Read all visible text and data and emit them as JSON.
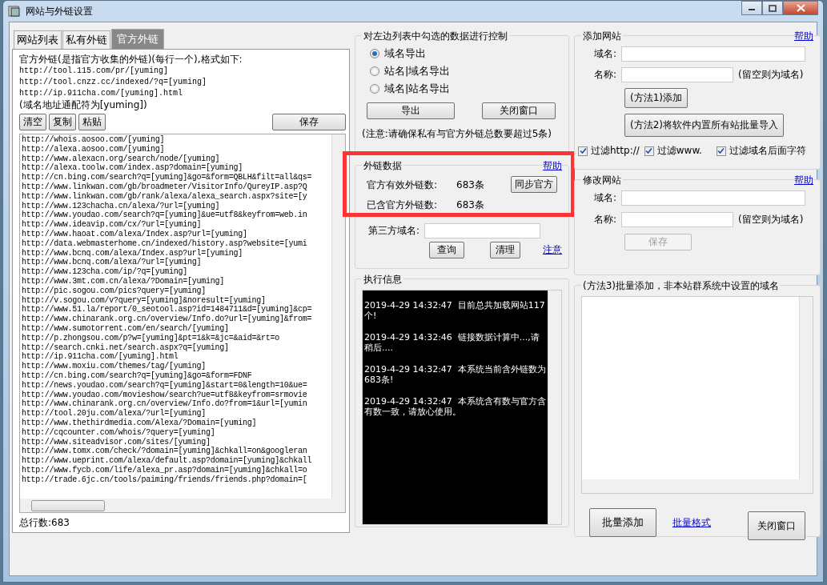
{
  "window": {
    "title": "网站与外链设置"
  },
  "tabs": [
    {
      "label": "网站列表",
      "selected": false
    },
    {
      "label": "私有外链",
      "selected": false
    },
    {
      "label": "官方外链",
      "selected": true
    }
  ],
  "official_links": {
    "description": "官方外链(是指官方收集的外链)(每行一个),格式如下:",
    "examples": [
      "http://tool.115.com/pr/[yuming]",
      "http://tool.cnzz.cc/indexed/?q=[yuming]",
      "http://ip.911cha.com/[yuming].html"
    ],
    "wildcard_note": "(域名地址通配符为[yuming])",
    "buttons": [
      "清空",
      "复制",
      "粘贴"
    ],
    "save_button": "保存",
    "lines": [
      "http://whois.aosoo.com/[yuming]",
      "http://alexa.aosoo.com/[yuming]",
      "http://www.alexacn.org/search/node/[yuming]",
      "http://alexa.toolw.com/index.asp?domain=[yuming]",
      "http://cn.bing.com/search?q=[yuming]&go=&form=QBLH&filt=all&qs=",
      "http://www.linkwan.com/gb/broadmeter/VisitorInfo/QureyIP.asp?Q",
      "http://www.linkwan.com/gb/rank/alexa/alexa_search.aspx?site=[y",
      "http://www.123chacha.cn/alexa/?url=[yuming]",
      "http://www.youdao.com/search?q=[yuming]&ue=utf8&keyfrom=web.in",
      "http://www.ideavip.com/cx/?url=[yuming]",
      "http://www.haoat.com/alexa/Index.asp?url=[yuming]",
      "http://data.webmasterhome.cn/indexed/history.asp?website=[yumi",
      "http://www.bcnq.com/alexa/Index.asp?url=[yuming]",
      "http://www.bcnq.com/alexa/?url=[yuming]",
      "http://www.123cha.com/ip/?q=[yuming]",
      "http://www.3mt.com.cn/alexa/?Domain=[yuming]",
      "http://pic.sogou.com/pics?query=[yuming]",
      "http://v.sogou.com/v?query=[yuming]&noresult=[yuming]",
      "http://www.51.la/report/0_seotool.asp?id=1484711&d=[yuming]&cp=",
      "http://www.chinarank.org.cn/overview/Info.do?url=[yuming]&from=",
      "http://www.sumotorrent.com/en/search/[yuming]",
      "http://p.zhongsou.com/p?w=[yuming]&pt=1&k=&jc=&aid=&rt=o",
      "http://search.cnki.net/search.aspx?q=[yuming]",
      "http://ip.911cha.com/[yuming].html",
      "http://www.moxiu.com/themes/tag/[yuming]",
      "http://cn.bing.com/search?q=[yuming]&go=&form=FDNF",
      "http://news.youdao.com/search?q=[yuming]&start=0&length=10&ue=",
      "http://www.youdao.com/movieshow/search?ue=utf8&keyfrom=srmovie",
      "http://www.chinarank.org.cn/overview/Info.do?from=1&url=[yumin",
      "http://tool.20ju.com/alexa/?url=[yuming]",
      "http://www.thethirdmedia.com/Alexa/?Domain=[yuming]",
      "http://cqcounter.com/whois/?query=[yuming]",
      "http://www.siteadvisor.com/sites/[yuming]",
      "http://www.tomx.com/check/?domain=[yuming]&chkall=on&googleran",
      "http://www.ueprint.com/alexa/default.asp?domain=[yuming]&chkall",
      "http://www.fycb.com/life/alexa_pr.asp?domain=[yuming]&chkall=o",
      "http://trade.6jc.cn/tools/paiming/friends/friends.php?domain=["
    ],
    "total": "总行数:683"
  },
  "export_control": {
    "title": "对左边列表中勾选的数据进行控制",
    "options": [
      {
        "label": "域名导出",
        "selected": true
      },
      {
        "label": "站名|域名导出",
        "selected": false
      },
      {
        "label": "域名|站名导出",
        "selected": false
      }
    ],
    "export_button": "导出",
    "close_button": "关闭窗口",
    "note": "(注意:请确保私有与官方外链总数要超过5条)"
  },
  "link_data": {
    "title": "外链数据",
    "help": "帮助",
    "rows": [
      {
        "label": "官方有效外链数:",
        "value": "683条"
      },
      {
        "label": "已含官方外链数:",
        "value": "683条"
      }
    ],
    "sync_button": "同步官方",
    "third_party_label": "第三方域名:",
    "query_button": "查询",
    "clean_button": "清理",
    "notice_link": "注意"
  },
  "log": {
    "title": "执行信息",
    "entries": [
      {
        "time": "2019-4-29 14:32:47",
        "message": "目前总共加载网站117个!"
      },
      {
        "time": "2019-4-29 14:32:46",
        "message": "链接数据计算中...,请稍后...."
      },
      {
        "time": "2019-4-29 14:32:47",
        "message": "本系统当前含外链数为683条!"
      },
      {
        "time": "2019-4-29 14:32:47",
        "message": "本系统含有数与官方含有数一致，请放心使用。"
      }
    ]
  },
  "add_site": {
    "title": "添加网站",
    "help": "帮助",
    "domain_label": "域名:",
    "name_label": "名称:",
    "name_hint": "(留空则为域名)",
    "method1_button": "(方法1)添加",
    "method2_button": "(方法2)将软件内置所有站批量导入",
    "filters": [
      {
        "label": "过滤http://",
        "checked": true
      },
      {
        "label": "过滤www.",
        "checked": true
      },
      {
        "label": "过滤域名后面字符",
        "checked": true
      }
    ]
  },
  "edit_site": {
    "title": "修改网站",
    "help": "帮助",
    "domain_label": "域名:",
    "name_label": "名称:",
    "name_hint": "(留空则为域名)",
    "save_button": {
      "label": "保存",
      "disabled": true
    }
  },
  "batch_add": {
    "title": "(方法3)批量添加，非本站群系统中设置的域名",
    "add_button": "批量添加",
    "format_link": "批量格式",
    "close_button": "关闭窗口"
  }
}
